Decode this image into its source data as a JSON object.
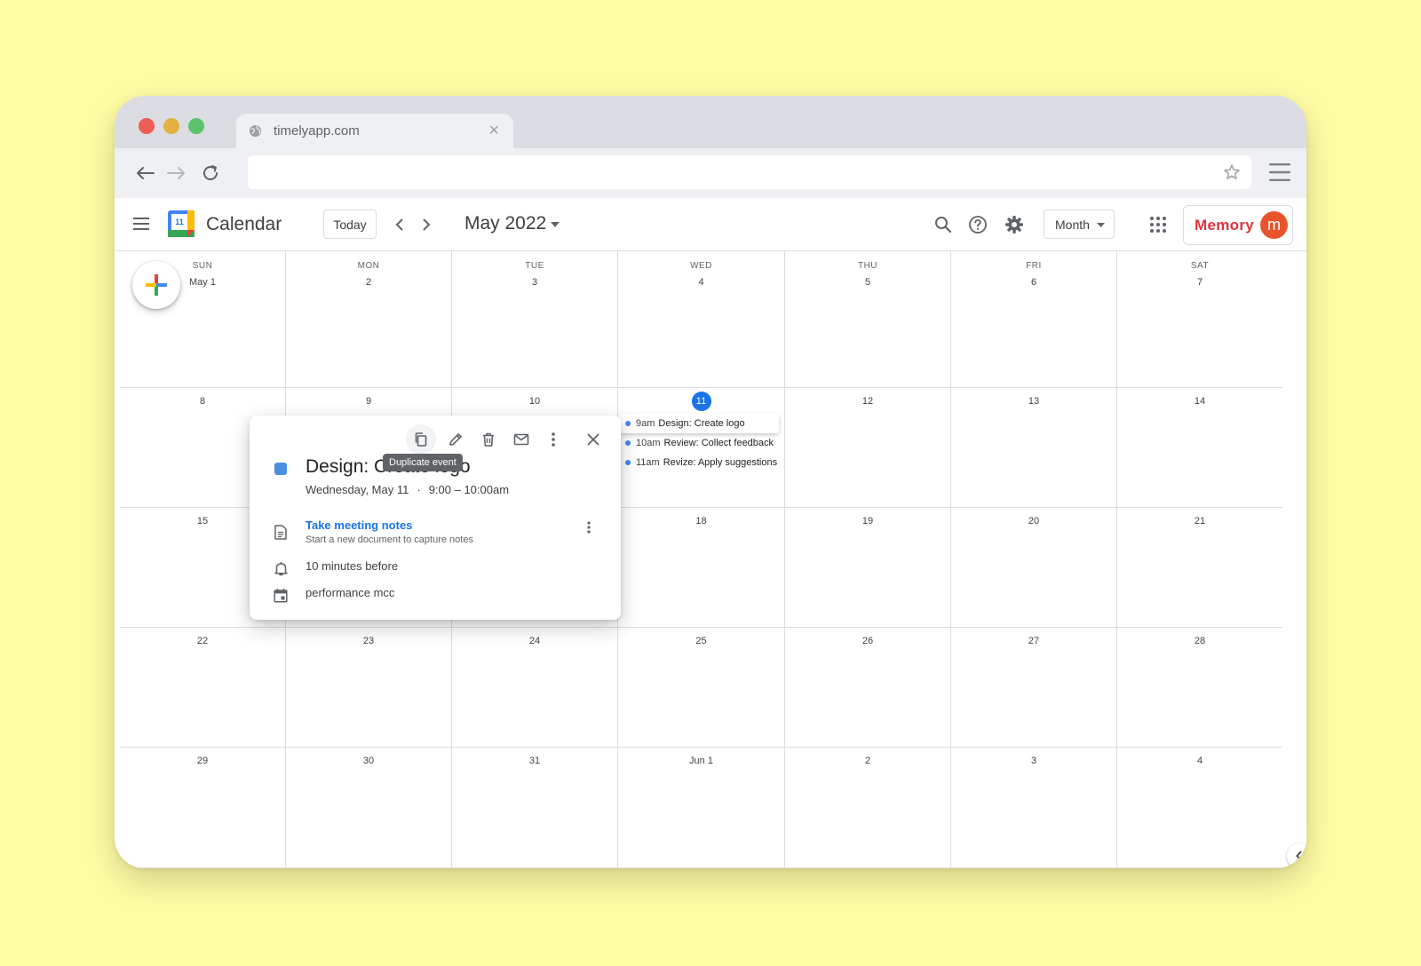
{
  "browser": {
    "tab_title": "timelyapp.com",
    "tab_close": "×",
    "url": ""
  },
  "header": {
    "app_title": "Calendar",
    "logo_day": "11",
    "today_label": "Today",
    "month_title": "May 2022",
    "view_label": "Month",
    "brand": "Memory",
    "avatar_initial": "m"
  },
  "calendar": {
    "weekdays": [
      "SUN",
      "MON",
      "TUE",
      "WED",
      "THU",
      "FRI",
      "SAT"
    ],
    "weeks": [
      [
        "May 1",
        "2",
        "3",
        "4",
        "5",
        "6",
        "7"
      ],
      [
        "8",
        "9",
        "10",
        "11",
        "12",
        "13",
        "14"
      ],
      [
        "15",
        "16",
        "17",
        "18",
        "19",
        "20",
        "21"
      ],
      [
        "22",
        "23",
        "24",
        "25",
        "26",
        "27",
        "28"
      ],
      [
        "29",
        "30",
        "31",
        "Jun 1",
        "2",
        "3",
        "4"
      ]
    ],
    "today": "11",
    "events": [
      {
        "time": "9am",
        "title": "Design: Create logo",
        "selected": true
      },
      {
        "time": "10am",
        "title": "Review: Collect feedback",
        "selected": false
      },
      {
        "time": "11am",
        "title": "Revize: Apply suggestions",
        "selected": false
      }
    ]
  },
  "popup": {
    "tooltip": "Duplicate event",
    "title": "Design: Create logo",
    "date": "Wednesday, May 11",
    "separator": "·",
    "time_range": "9:00 – 10:00am",
    "notes_link": "Take meeting notes",
    "notes_sub": "Start a new document to capture notes",
    "reminder": "10 minutes before",
    "calendar_name": "performance mcc",
    "event_color": "#4a90e2"
  },
  "colors": {
    "background": "#fffda4",
    "accent": "#1a73e8",
    "brand": "#e0323b",
    "avatar": "#e8542b"
  }
}
